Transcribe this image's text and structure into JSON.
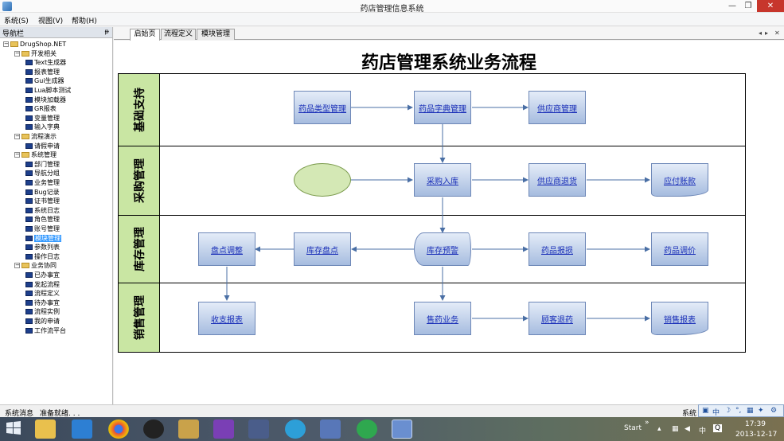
{
  "window": {
    "title": "药店管理信息系统",
    "min": "—",
    "max": "❐",
    "close": "✕"
  },
  "menu": [
    "系统(S)",
    "视图(V)",
    "帮助(H)"
  ],
  "nav": {
    "header": "导航栏",
    "pin": "ᵽ",
    "root": "DrugShop.NET",
    "groups": [
      {
        "label": "开发相关",
        "items": [
          "Text生成器",
          "报表管理",
          "Gui生成器",
          "Lua脚本测试",
          "模块加载器",
          "GR报表",
          "变量管理",
          "输入字典"
        ]
      },
      {
        "label": "流程演示",
        "items": [
          "请假申请"
        ]
      },
      {
        "label": "系统管理",
        "items": [
          "部门管理",
          "导航分组",
          "业务管理",
          "Bug记录",
          "证书管理",
          "系统日志",
          "角色管理",
          "账号管理",
          "模块管理",
          "参数列表",
          "操作日志"
        ]
      },
      {
        "label": "业务协同",
        "items": [
          "已办事宜",
          "发起流程",
          "流程定义",
          "待办事宜",
          "流程实例",
          "我的申请",
          "工作流平台"
        ]
      }
    ],
    "selected": "模块管理"
  },
  "tabs": [
    "启始页",
    "流程定义",
    "模块管理"
  ],
  "diagram": {
    "title": "药店管理系统业务流程",
    "lanes": [
      "基础支持",
      "采购管理",
      "库存管理",
      "销售管理"
    ],
    "nodes": {
      "drug_type": "药品类型管理",
      "drug_dict": "药品字典管理",
      "supplier": "供应商管理",
      "purchase_in": "采购入库",
      "supplier_return": "供应商退货",
      "payable": "应付账款",
      "stock_adjust": "盘点调整",
      "stock_check": "库存盘点",
      "stock_alert": "库存预警",
      "drug_loss": "药品报损",
      "drug_price": "药品调价",
      "income_report": "收支报表",
      "sales": "售药业务",
      "customer_return": "顾客退药",
      "sales_report": "销售报表"
    }
  },
  "status": {
    "label": "系统消息",
    "message": "准备就绪. . .",
    "right": "系统"
  },
  "ime": [
    "中",
    "☽",
    "°,",
    "▦",
    "✦",
    "⚙"
  ],
  "taskbar": {
    "start": "Start",
    "time": "17:39",
    "date": "2013-12-17",
    "lang": "中"
  },
  "colors": {
    "accent": "#3399ff",
    "lane_label": "#c9e6a3",
    "close": "#c7362c",
    "link": "#1a2fb8"
  }
}
